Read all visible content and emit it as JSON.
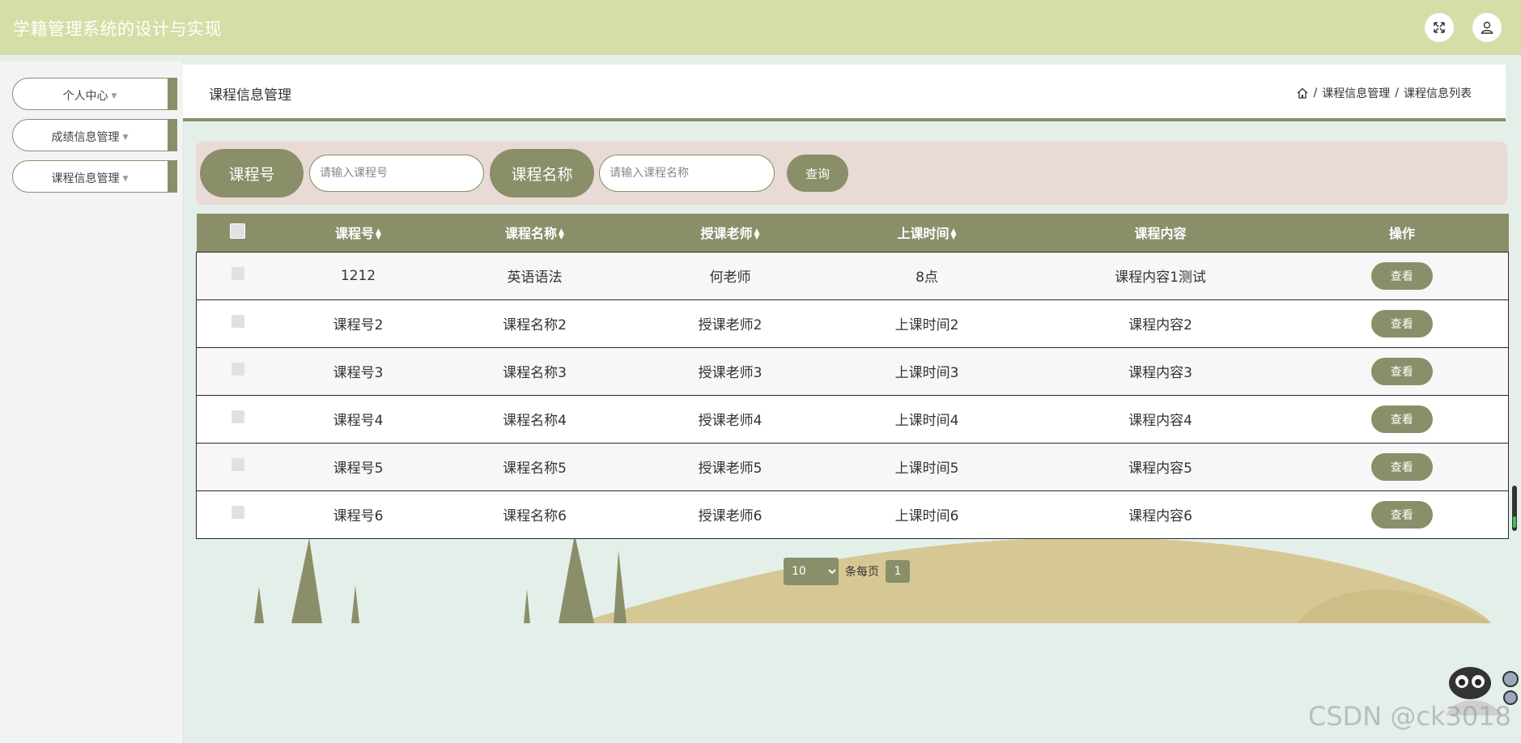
{
  "header": {
    "title": "学籍管理系统的设计与实现",
    "icons": [
      "fullscreen-icon",
      "user-icon"
    ]
  },
  "sidebar": {
    "items": [
      {
        "label": "个人中心"
      },
      {
        "label": "成绩信息管理"
      },
      {
        "label": "课程信息管理"
      }
    ]
  },
  "content": {
    "title": "课程信息管理",
    "breadcrumb": [
      "课程信息管理",
      "课程信息列表"
    ]
  },
  "search": {
    "course_no_label": "课程号",
    "course_no_placeholder": "请输入课程号",
    "course_name_label": "课程名称",
    "course_name_placeholder": "请输入课程名称",
    "query_label": "查询"
  },
  "table": {
    "columns": [
      "课程号",
      "课程名称",
      "授课老师",
      "上课时间",
      "课程内容",
      "操作"
    ],
    "rows": [
      {
        "no": "1212",
        "name": "英语语法",
        "teacher": "何老师",
        "time": "8点",
        "content": "课程内容1测试",
        "action": "查看"
      },
      {
        "no": "课程号2",
        "name": "课程名称2",
        "teacher": "授课老师2",
        "time": "上课时间2",
        "content": "课程内容2",
        "action": "查看"
      },
      {
        "no": "课程号3",
        "name": "课程名称3",
        "teacher": "授课老师3",
        "time": "上课时间3",
        "content": "课程内容3",
        "action": "查看"
      },
      {
        "no": "课程号4",
        "name": "课程名称4",
        "teacher": "授课老师4",
        "time": "上课时间4",
        "content": "课程内容4",
        "action": "查看"
      },
      {
        "no": "课程号5",
        "name": "课程名称5",
        "teacher": "授课老师5",
        "time": "上课时间5",
        "content": "课程内容5",
        "action": "查看"
      },
      {
        "no": "课程号6",
        "name": "课程名称6",
        "teacher": "授课老师6",
        "time": "上课时间6",
        "content": "课程内容6",
        "action": "查看"
      }
    ]
  },
  "pagination": {
    "page_size": "10",
    "per_page_label": "条每页",
    "current_page": "1"
  },
  "watermark": "CSDN @ck3018",
  "colors": {
    "header_bg": "#d3dfa6",
    "accent": "#8a8f6a",
    "search_panel_bg": "#e9dad6",
    "page_bg": "#e5efea",
    "hill": "#d6c894"
  }
}
